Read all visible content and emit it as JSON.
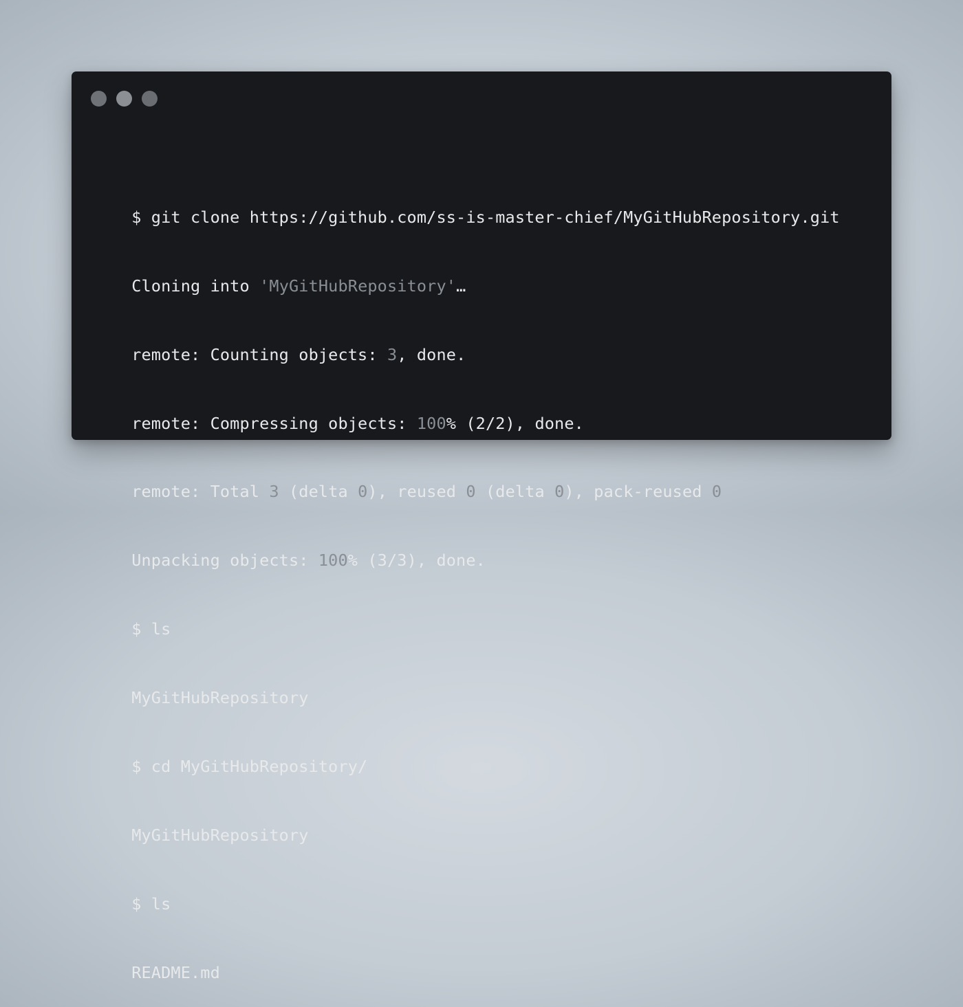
{
  "window": {
    "controls": [
      "close-dot",
      "minimize-dot",
      "maximize-dot"
    ],
    "background_color": "#17191c"
  },
  "terminal": {
    "lines": [
      {
        "parts": [
          {
            "text": "$ git clone https://github.com/ss-is-master-chief/MyGitHubRepository.git",
            "style": "normal"
          }
        ]
      },
      {
        "parts": [
          {
            "text": "Cloning into ",
            "style": "normal"
          },
          {
            "text": "'MyGitHubRepository'",
            "style": "muted"
          },
          {
            "text": "…",
            "style": "normal"
          }
        ]
      },
      {
        "parts": [
          {
            "text": "remote: Counting objects: ",
            "style": "normal"
          },
          {
            "text": "3",
            "style": "muted"
          },
          {
            "text": ", done.",
            "style": "normal"
          }
        ]
      },
      {
        "parts": [
          {
            "text": "remote: Compressing objects: ",
            "style": "normal"
          },
          {
            "text": "100",
            "style": "muted"
          },
          {
            "text": "% (2/2), done.",
            "style": "normal"
          }
        ]
      },
      {
        "parts": [
          {
            "text": "remote: Total ",
            "style": "normal"
          },
          {
            "text": "3",
            "style": "muted"
          },
          {
            "text": " (delta ",
            "style": "normal"
          },
          {
            "text": "0",
            "style": "muted"
          },
          {
            "text": "), reused ",
            "style": "normal"
          },
          {
            "text": "0",
            "style": "muted"
          },
          {
            "text": " (delta ",
            "style": "normal"
          },
          {
            "text": "0",
            "style": "muted"
          },
          {
            "text": "), pack-reused ",
            "style": "normal"
          },
          {
            "text": "0",
            "style": "muted"
          }
        ]
      },
      {
        "parts": [
          {
            "text": "Unpacking objects: ",
            "style": "normal"
          },
          {
            "text": "100",
            "style": "muted"
          },
          {
            "text": "% (3/3), done.",
            "style": "normal"
          }
        ]
      },
      {
        "parts": [
          {
            "text": "$ ls",
            "style": "normal"
          }
        ]
      },
      {
        "parts": [
          {
            "text": "MyGitHubRepository",
            "style": "normal"
          }
        ]
      },
      {
        "parts": [
          {
            "text": "$ cd MyGitHubRepository/",
            "style": "normal"
          }
        ]
      },
      {
        "parts": [
          {
            "text": "MyGitHubRepository",
            "style": "normal"
          }
        ]
      },
      {
        "parts": [
          {
            "text": "$ ls",
            "style": "normal"
          }
        ]
      },
      {
        "parts": [
          {
            "text": "README.md",
            "style": "normal"
          }
        ]
      }
    ]
  }
}
